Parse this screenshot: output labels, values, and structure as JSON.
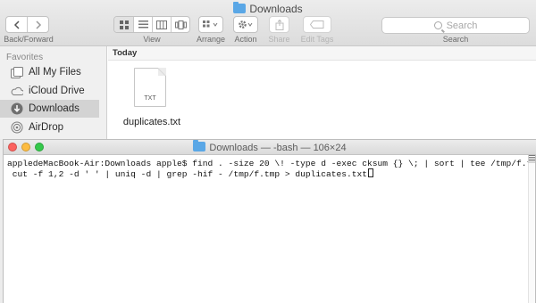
{
  "finder": {
    "title": "Downloads",
    "back_forward_label": "Back/Forward",
    "view_label": "View",
    "arrange_label": "Arrange",
    "action_label": "Action",
    "share_label": "Share",
    "edit_tags_label": "Edit Tags",
    "search_placeholder": "Search",
    "search_label": "Search",
    "sidebar": {
      "heading": "Favorites",
      "items": [
        {
          "label": "All My Files",
          "icon": "all-files-icon"
        },
        {
          "label": "iCloud Drive",
          "icon": "cloud-icon"
        },
        {
          "label": "Downloads",
          "icon": "download-icon",
          "selected": true
        },
        {
          "label": "AirDrop",
          "icon": "airdrop-icon"
        }
      ]
    },
    "section_title": "Today",
    "file": {
      "name": "duplicates.txt",
      "ext_label": "TXT"
    }
  },
  "terminal": {
    "title": "Downloads — -bash — 106×24",
    "lines": [
      "appledeMacBook-Air:Downloads apple$ find . -size 20 \\! -type d -exec cksum {} \\; | sort | tee /tmp/f.tmp |",
      " cut -f 1,2 -d ' ' | uniq -d | grep -hif - /tmp/f.tmp > duplicates.txt"
    ]
  },
  "colors": {
    "folder_blue": "#5aa7e6",
    "sidebar_selected": "#d3d3d3",
    "close": "#fc615d",
    "minimize": "#fdbc40",
    "zoom": "#34c84a"
  }
}
